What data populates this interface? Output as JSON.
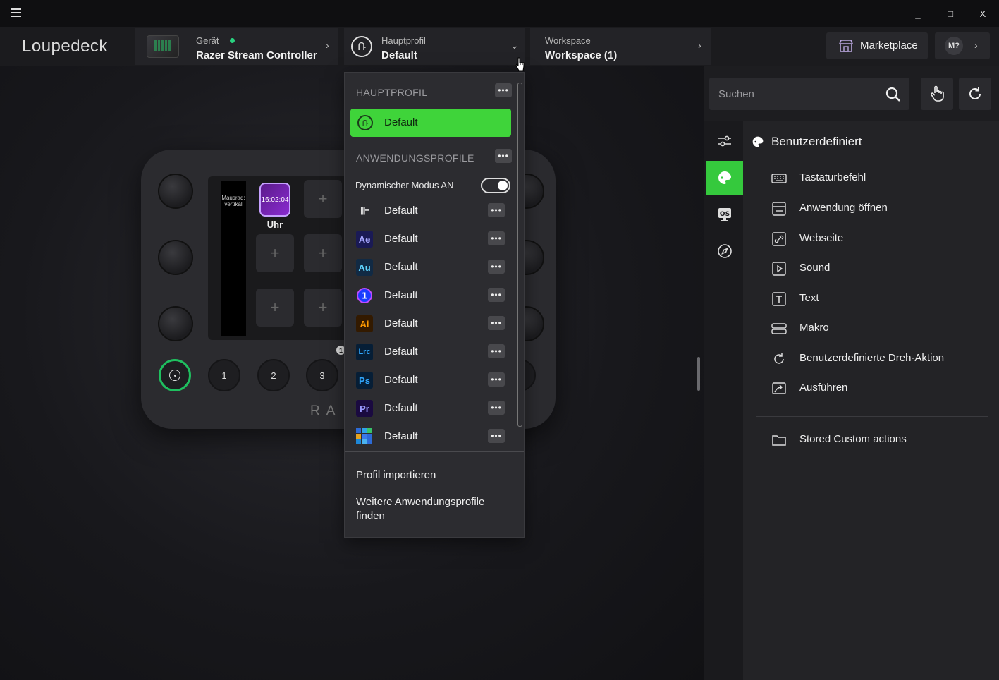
{
  "window": {
    "minimize": "_",
    "maximize": "□",
    "close": "X"
  },
  "header": {
    "logo": "Loupedeck",
    "device": {
      "label": "Gerät",
      "value": "Razer Stream Controller"
    },
    "profile": {
      "label": "Hauptprofil",
      "value": "Default"
    },
    "workspace": {
      "label": "Workspace",
      "value": "Workspace (1)"
    },
    "marketplace": "Marketplace",
    "account": "M?"
  },
  "device_preview": {
    "strip_text": "Mausrad: vertikal",
    "clock_time": "16:02:04",
    "clock_label": "Uhr",
    "plus": "+",
    "buttons": [
      "1",
      "2",
      "3"
    ],
    "brand": "RA",
    "info": "1"
  },
  "dropdown": {
    "main_section": "HAUPTPROFIL",
    "main_active": "Default",
    "app_section": "ANWENDUNGSPROFILE",
    "dynamic_mode": "Dynamischer Modus AN",
    "dots": "•••",
    "apps": [
      {
        "icon": "stream-icon",
        "icon_text": "|||≡",
        "name": "Default",
        "bg": "#2c2c30",
        "fg": "#dddddd"
      },
      {
        "icon": "after-effects-icon",
        "icon_text": "Ae",
        "name": "Default",
        "bg": "#1a1a55",
        "fg": "#a7a7ff"
      },
      {
        "icon": "audition-icon",
        "icon_text": "Au",
        "name": "Default",
        "bg": "#112a44",
        "fg": "#5fd5ff"
      },
      {
        "icon": "onepassword-icon",
        "icon_text": "1",
        "name": "Default",
        "bg": "#2c2c30",
        "fg": "#ffffff"
      },
      {
        "icon": "illustrator-icon",
        "icon_text": "Ai",
        "name": "Default",
        "bg": "#331a00",
        "fg": "#ff9a00"
      },
      {
        "icon": "lightroom-classic-icon",
        "icon_text": "Lrc",
        "name": "Default",
        "bg": "#061e36",
        "fg": "#30a8ff"
      },
      {
        "icon": "photoshop-icon",
        "icon_text": "Ps",
        "name": "Default",
        "bg": "#061e36",
        "fg": "#31a8ff"
      },
      {
        "icon": "premiere-icon",
        "icon_text": "Pr",
        "name": "Default",
        "bg": "#1a0a40",
        "fg": "#9999ff"
      },
      {
        "icon": "windows-grid-icon",
        "icon_text": "",
        "name": "Default",
        "bg": "#2c2c30",
        "fg": "#ffffff"
      }
    ],
    "import": "Profil importieren",
    "more": "Weitere Anwendungsprofile finden"
  },
  "right_panel": {
    "search_placeholder": "Suchen",
    "category_title": "Benutzerdefiniert",
    "actions": [
      {
        "icon": "keyboard-icon",
        "label": "Tastaturbefehl"
      },
      {
        "icon": "app-window-icon",
        "label": "Anwendung öffnen"
      },
      {
        "icon": "link-icon",
        "label": "Webseite"
      },
      {
        "icon": "play-icon",
        "label": "Sound"
      },
      {
        "icon": "text-icon",
        "label": "Text"
      },
      {
        "icon": "macro-icon",
        "label": "Makro"
      },
      {
        "icon": "rotate-icon",
        "label": "Benutzerdefinierte Dreh-Aktion"
      },
      {
        "icon": "run-icon",
        "label": "Ausführen"
      }
    ],
    "stored": {
      "icon": "folder-icon",
      "label": "Stored Custom actions"
    }
  },
  "colors": {
    "accent_green": "#3fd43a",
    "status_dot": "#29d17f"
  }
}
